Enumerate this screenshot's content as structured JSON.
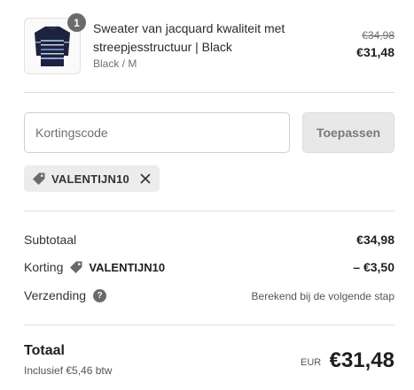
{
  "product": {
    "quantity": "1",
    "title": "Sweater van jacquard kwaliteit met streepjesstructuur | Black",
    "variant": "Black / M",
    "old_price": "€34,98",
    "new_price": "€31,48",
    "image_icon": "sweater-image"
  },
  "discount": {
    "placeholder": "Kortingscode",
    "apply_label": "Toepassen",
    "applied_code": "VALENTIJN10",
    "tag_icon": "tag-icon",
    "remove_icon": "close-icon"
  },
  "summary": {
    "subtotal_label": "Subtotaal",
    "subtotal_value": "€34,98",
    "discount_label": "Korting",
    "discount_code": "VALENTIJN10",
    "discount_value": "– €3,50",
    "shipping_label": "Verzending",
    "shipping_value": "Berekend bij de volgende stap",
    "help_icon": "?"
  },
  "total": {
    "label": "Totaal",
    "tax_note": "Inclusief €5,46 btw",
    "currency": "EUR",
    "amount": "€31,48"
  },
  "colors": {
    "badge": "#6b6b6b",
    "button_disabled_bg": "#e8e8e8",
    "tag_bg": "#ececec"
  }
}
